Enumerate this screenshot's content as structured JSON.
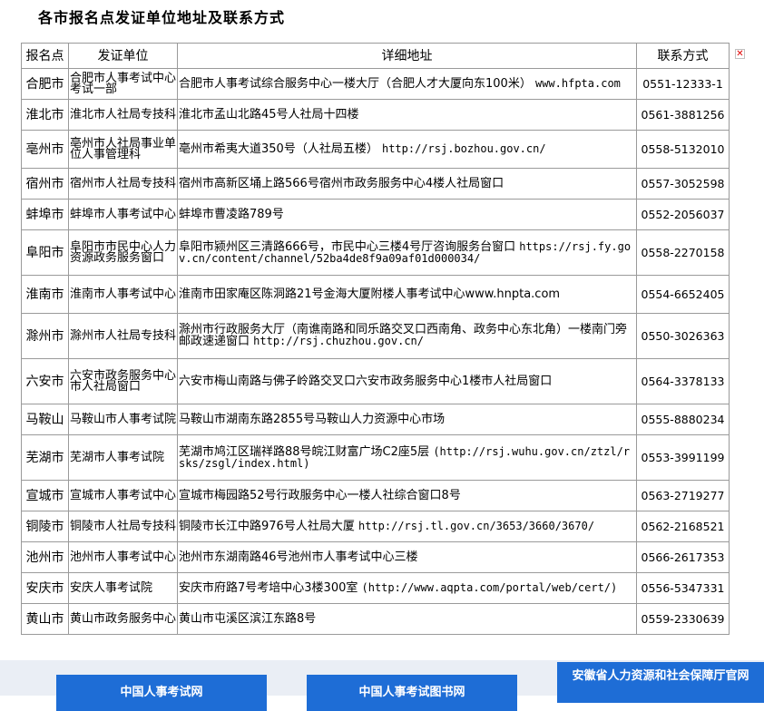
{
  "page": {
    "title": "各市报名点发证单位地址及联系方式"
  },
  "close_icon_glyph": "✕",
  "table": {
    "headers": {
      "city": "报名点",
      "unit": "发证单位",
      "address": "详细地址",
      "phone": "联系方式"
    },
    "rows": [
      {
        "city": "合肥市",
        "unit": "合肥市人事考试中心考试一部",
        "address": "合肥市人事考试综合服务中心一楼大厅（合肥人才大厦向东100米）",
        "url": "www.hfpta.com",
        "phone": "0551-12333-1"
      },
      {
        "city": "淮北市",
        "unit": "淮北市人社局专技科",
        "address": "淮北市孟山北路45号人社局十四楼",
        "url": "",
        "phone": "0561-3881256"
      },
      {
        "city": "亳州市",
        "unit": "亳州市人社局事业单位人事管理科",
        "address": "亳州市希夷大道350号（人社局五楼）",
        "url": "http://rsj.bozhou.gov.cn/",
        "phone": "0558-5132010"
      },
      {
        "city": "宿州市",
        "unit": "宿州市人社局专技科",
        "address": "宿州市高新区埇上路566号宿州市政务服务中心4楼人社局窗口",
        "url": "",
        "phone": "0557-3052598"
      },
      {
        "city": "蚌埠市",
        "unit": "蚌埠市人事考试中心",
        "address": "蚌埠市曹凌路789号",
        "url": "",
        "phone": "0552-2056037"
      },
      {
        "city": "阜阳市",
        "unit": "阜阳市市民中心人力资源政务服务窗口",
        "address": "阜阳市颍州区三清路666号，市民中心三楼4号厅咨询服务台窗口",
        "url": "https://rsj.fy.gov.cn/content/channel/52ba4de8f9a09af01d000034/",
        "phone": "0558-2270158"
      },
      {
        "city": "淮南市",
        "unit": "淮南市人事考试中心",
        "address": "淮南市田家庵区陈洞路21号金海大厦附楼人事考试中心www.hnpta.com",
        "url": "",
        "phone": "0554-6652405"
      },
      {
        "city": "滁州市",
        "unit": "滁州市人社局专技科",
        "address": "滁州市行政服务大厅（南谯南路和同乐路交叉口西南角、政务中心东北角）一楼南门旁邮政速递窗口",
        "url": "http://rsj.chuzhou.gov.cn/",
        "phone": "0550-3026363"
      },
      {
        "city": "六安市",
        "unit": "六安市政务服务中心市人社局窗口",
        "address": "六安市梅山南路与佛子岭路交叉口六安市政务服务中心1楼市人社局窗口",
        "url": "",
        "phone": "0564-3378133"
      },
      {
        "city": "马鞍山",
        "unit": "马鞍山市人事考试院",
        "address": "马鞍山市湖南东路2855号马鞍山人力资源中心市场",
        "url": "",
        "phone": "0555-8880234"
      },
      {
        "city": "芜湖市",
        "unit": "芜湖市人事考试院",
        "address": "芜湖市鸠江区瑞祥路88号皖江财富广场C2座5层",
        "url": "(http://rsj.wuhu.gov.cn/ztzl/rsks/zsgl/index.html)",
        "phone": "0553-3991199"
      },
      {
        "city": "宣城市",
        "unit": "宣城市人事考试中心",
        "address": "宣城市梅园路52号行政服务中心一楼人社综合窗口8号",
        "url": "",
        "phone": "0563-2719277"
      },
      {
        "city": "铜陵市",
        "unit": "铜陵市人社局专技科",
        "address": "铜陵市长江中路976号人社局大厦",
        "url": "http://rsj.tl.gov.cn/3653/3660/3670/",
        "phone": "0562-2168521"
      },
      {
        "city": "池州市",
        "unit": "池州市人事考试中心",
        "address": "池州市东湖南路46号池州市人事考试中心三楼",
        "url": "",
        "phone": "0566-2617353"
      },
      {
        "city": "安庆市",
        "unit": "安庆人事考试院",
        "address": "安庆市府路7号考培中心3楼300室",
        "url": "(http://www.aqpta.com/portal/web/cert/)",
        "phone": "0556-5347331"
      },
      {
        "city": "黄山市",
        "unit": "黄山市政务服务中心",
        "address": "黄山市屯溪区滨江东路8号",
        "url": "",
        "phone": "0559-2330639"
      }
    ]
  },
  "footer": {
    "links": [
      "中国人事考试网",
      "中国人事考试图书网",
      "安徽省人力资源和社会保障厅官网"
    ]
  },
  "colors": {
    "button": "#1e6dd6",
    "border": "#9a9a9a",
    "footer_band": "#eaeef5",
    "close": "#e00000"
  }
}
